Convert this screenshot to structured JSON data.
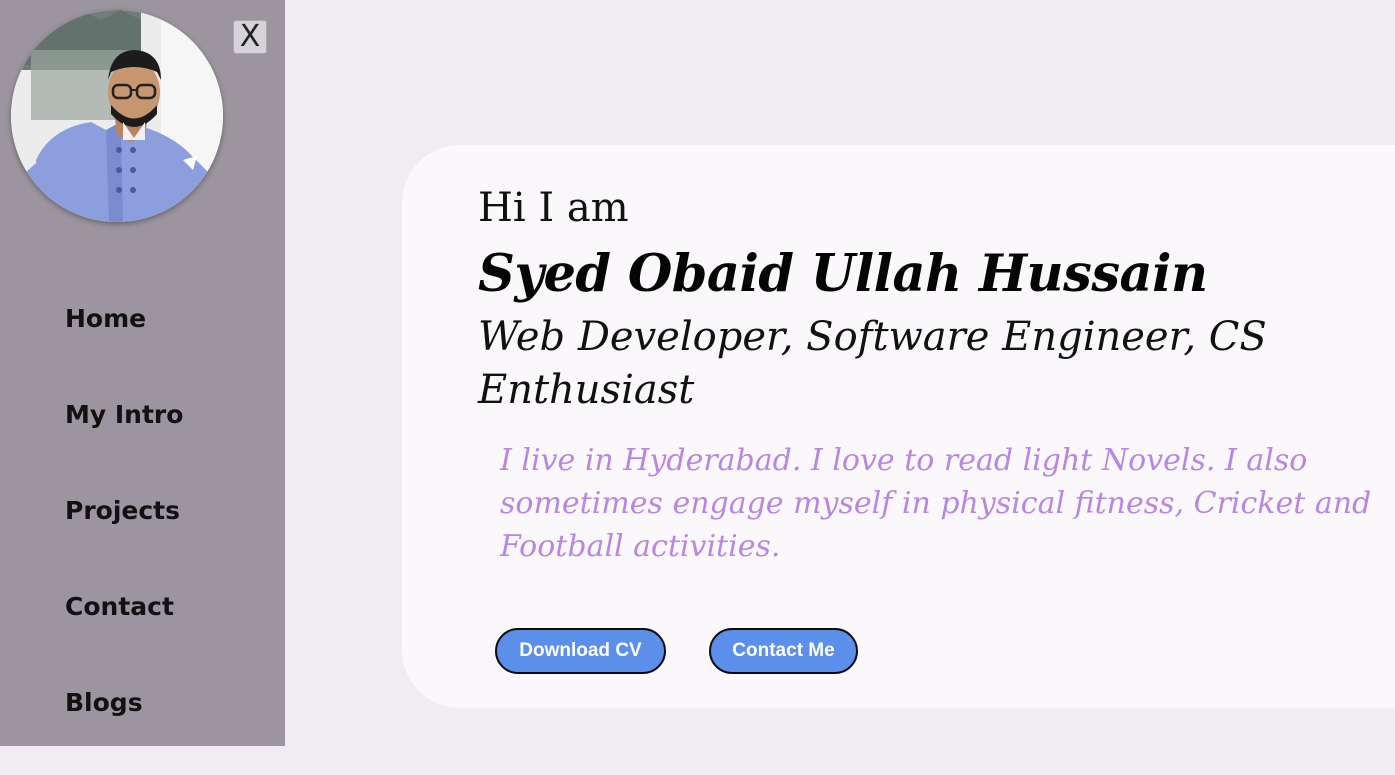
{
  "sidebar": {
    "close_label": "X",
    "nav_items": [
      {
        "label": "Home"
      },
      {
        "label": "My Intro"
      },
      {
        "label": "Projects"
      },
      {
        "label": "Contact"
      },
      {
        "label": "Blogs"
      }
    ]
  },
  "hero": {
    "greeting": "Hi I am",
    "name": "Syed Obaid Ullah Hussain",
    "role": "Web Developer, Software Engineer, CS Enthusiast",
    "bio": "I live in Hyderabad. I love to read light Novels. I also sometimes engage myself in physical fitness, Cricket and Football activities.",
    "buttons": {
      "download_cv": "Download CV",
      "contact_me": "Contact Me"
    }
  },
  "colors": {
    "sidebar_bg": "#9c949f",
    "page_bg": "#f0ecf1",
    "card_bg": "#faf8fb",
    "bio_text": "#b986e2",
    "button_bg": "#5b8fea"
  }
}
